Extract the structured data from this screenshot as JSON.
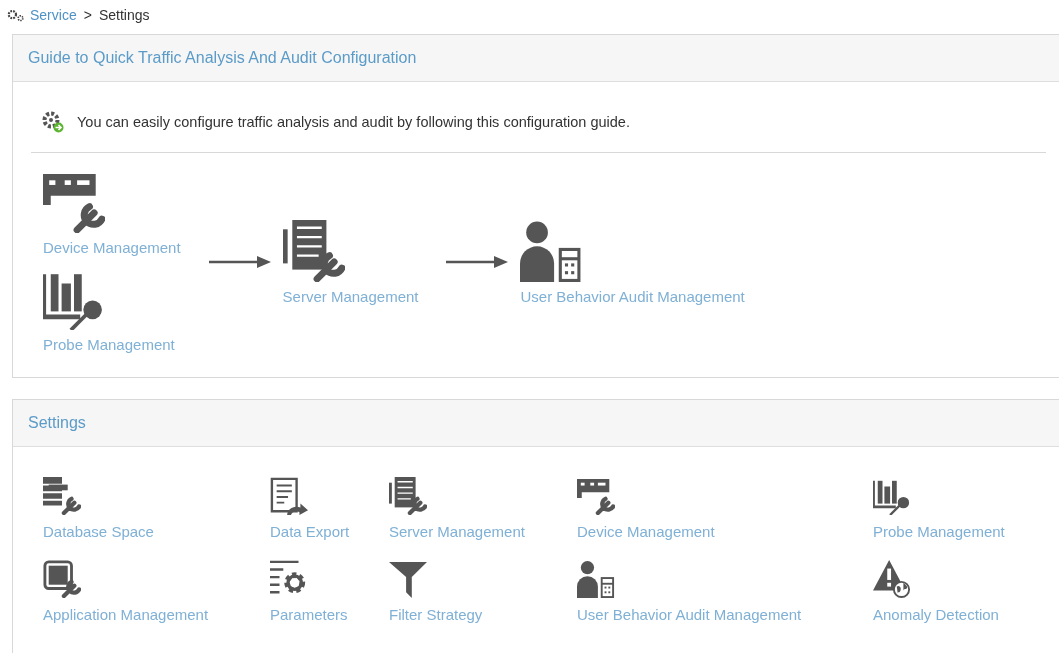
{
  "breadcrumb": {
    "link": "Service",
    "separator": ">",
    "current": "Settings"
  },
  "guide": {
    "title": "Guide to Quick Traffic Analysis And Audit Configuration",
    "intro": "You can easily configure traffic analysis and audit by following this configuration guide.",
    "steps": [
      [
        {
          "label": "Device Management",
          "kind": "device"
        },
        {
          "label": "Probe Management",
          "kind": "probe"
        }
      ],
      [
        {
          "label": "Server Management",
          "kind": "server"
        }
      ],
      [
        {
          "label": "User Behavior Audit Management",
          "kind": "user"
        }
      ]
    ]
  },
  "settings": {
    "title": "Settings",
    "items": [
      {
        "label": "Database Space",
        "kind": "database"
      },
      {
        "label": "Data Export",
        "kind": "export"
      },
      {
        "label": "Server Management",
        "kind": "server"
      },
      {
        "label": "Device Management",
        "kind": "device"
      },
      {
        "label": "Probe Management",
        "kind": "probe"
      },
      {
        "label": "Application Management",
        "kind": "application"
      },
      {
        "label": "Parameters",
        "kind": "parameters"
      },
      {
        "label": "Filter Strategy",
        "kind": "filter"
      },
      {
        "label": "User Behavior Audit Management",
        "kind": "user"
      },
      {
        "label": "Anomaly Detection",
        "kind": "anomaly"
      }
    ]
  }
}
